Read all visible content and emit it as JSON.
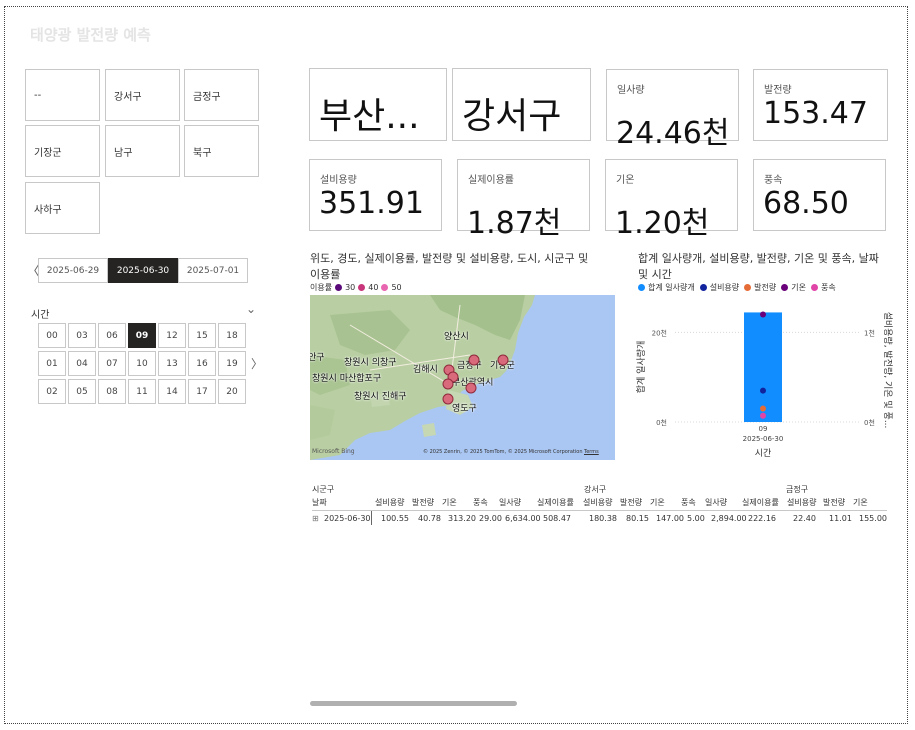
{
  "app": {
    "title": "태양광 발전량 예측"
  },
  "district_slicer": [
    "--",
    "강서구",
    "금정구",
    "기장군",
    "남구",
    "북구",
    "사하구"
  ],
  "date_slicer": {
    "dates": [
      "2025-06-29",
      "2025-06-30",
      "2025-07-01"
    ],
    "selected": "2025-06-30",
    "prev_glyph": "〈"
  },
  "hour_slicer": {
    "label": "시간",
    "chevron": "⌄",
    "next_glyph": "〉",
    "hours": [
      [
        "00",
        "03",
        "06",
        "09",
        "12",
        "15",
        "18"
      ],
      [
        "01",
        "04",
        "07",
        "10",
        "13",
        "16",
        "19"
      ],
      [
        "02",
        "05",
        "08",
        "11",
        "14",
        "17",
        "20"
      ]
    ],
    "selected": "09"
  },
  "cards": {
    "city": "부산...",
    "district": "강서구",
    "irradiance": {
      "label": "일사량",
      "value": "24.46천"
    },
    "generation": {
      "label": "발전량",
      "value": "153.47"
    },
    "capacity": {
      "label": "설비용량",
      "value": "351.91"
    },
    "utilization": {
      "label": "실제이용률",
      "value": "1.87천"
    },
    "temperature": {
      "label": "기온",
      "value": "1.20천"
    },
    "wind": {
      "label": "풍속",
      "value": "68.50"
    }
  },
  "map_visual": {
    "title": "위도, 경도, 실제이용률, 발전량 및 설비용량, 도시, 시군구 및 이용률",
    "legend_label": "이용률",
    "legend_items": [
      {
        "label": "30",
        "color": "#5b0a7a"
      },
      {
        "label": "40",
        "color": "#c8357a"
      },
      {
        "label": "50",
        "color": "#e865b0"
      }
    ],
    "labels": [
      "양산시",
      "창원시 의창구",
      "김해시",
      "금정구",
      "기장군",
      "창원시 마산합포구",
      "동래구",
      "부산광역시",
      "창원시 진해구",
      "영도구",
      "안구"
    ],
    "credit": "© 2025 Zenrin, © 2025 TomTom, © 2025 Microsoft Corporation",
    "terms": "Terms",
    "brand": "Microsoft Bing"
  },
  "chart_data": {
    "type": "bar",
    "title": "합계 일사량개, 설비용량, 발전량, 기온 및 풍속, 날짜 및 시간",
    "categories": [
      "09"
    ],
    "category_sublabel": "2025-06-30",
    "xlabel": "시간",
    "ylabel": "합계 일사량개",
    "y2label": "설비용량, 발전량, 기온 및 풍...",
    "yticks": [
      "0천",
      "20천"
    ],
    "y2ticks": [
      "0천",
      "1천"
    ],
    "ylim": [
      0,
      25
    ],
    "y2lim": [
      0,
      1.25
    ],
    "legend": [
      "합계 일사량개",
      "설비용량",
      "발전량",
      "기온",
      "풍속"
    ],
    "colors": [
      "#118dff",
      "#12239e",
      "#e66c37",
      "#6b007b",
      "#e044a7"
    ],
    "series": [
      {
        "name": "합계 일사량개",
        "axis": "left",
        "values": [
          24.46
        ]
      },
      {
        "name": "설비용량",
        "axis": "right",
        "values": [
          0.35
        ]
      },
      {
        "name": "발전량",
        "axis": "right",
        "values": [
          0.15
        ]
      },
      {
        "name": "기온",
        "axis": "right",
        "values": [
          1.2
        ]
      },
      {
        "name": "풍속",
        "axis": "right",
        "values": [
          0.07
        ]
      }
    ]
  },
  "matrix": {
    "row_header_1": "시군구",
    "row_header_2": "날짜",
    "group_headers": [
      "강서구",
      "금정구"
    ],
    "columns": [
      "설비용량",
      "발전량",
      "기온",
      "풍속",
      "일사량",
      "실제이용률",
      "설비용량",
      "발전량",
      "기온",
      "풍속",
      "일사량",
      "실제이용률",
      "설비용량",
      "발전량",
      "기온"
    ],
    "row": {
      "label": "2025-06-30",
      "expand_glyph": "⊞",
      "values": [
        "100.55",
        "40.78",
        "313.20",
        "29.00",
        "6,634.00",
        "508.47",
        "180.38",
        "80.15",
        "147.00",
        "5.00",
        "2,894.00",
        "222.16",
        "22.40",
        "11.01",
        "155.00"
      ]
    }
  }
}
